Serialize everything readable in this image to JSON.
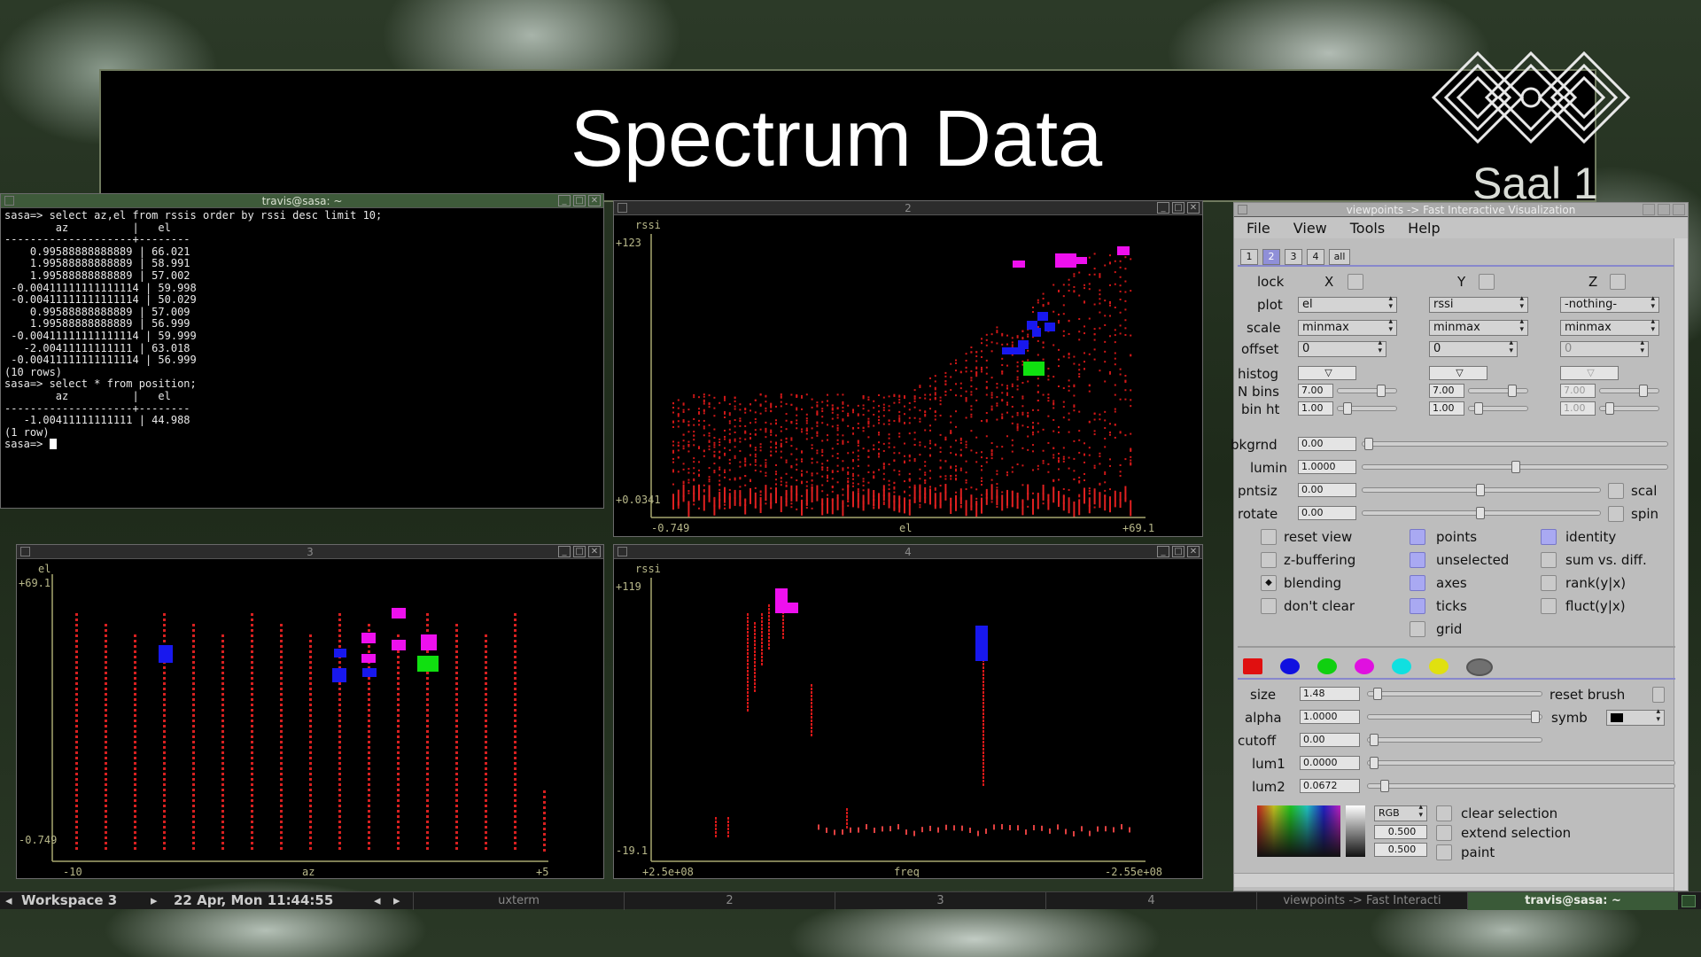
{
  "slide": {
    "title": "Spectrum Data",
    "logo_text": "Saal 1"
  },
  "terminal": {
    "title": "travis@sasa: ~",
    "lines": [
      "sasa=> select az,el from rssis order by rssi desc limit 10;",
      "        az          |   el",
      "--------------------+--------",
      "    0.99588888888889 | 66.021",
      "    1.99588888888889 | 58.991",
      "    1.99588888888889 | 57.002",
      " -0.00411111111111114 | 59.998",
      " -0.00411111111111114 | 50.029",
      "    0.99588888888889 | 57.009",
      "    1.99588888888889 | 56.999",
      " -0.00411111111111114 | 59.999",
      "   -2.00411111111111 | 63.018",
      " -0.00411111111111114 | 56.999",
      "(10 rows)",
      "",
      "sasa=> select * from position;",
      "        az          |   el",
      "--------------------+--------",
      "   -1.00411111111111 | 44.988",
      "(1 row)",
      "",
      "sasa=> "
    ]
  },
  "plot2": {
    "title": "2",
    "ylabel": "rssi",
    "xlabel": "el",
    "ymax": "+123",
    "ymin": "+0.0341",
    "xmin": "-0.749",
    "xmax": "+69.1"
  },
  "plot3": {
    "title": "3",
    "ylabel": "el",
    "xlabel": "az",
    "ymax": "+69.1",
    "ymin": "-0.749",
    "xmin": "-10",
    "xmax": "+5"
  },
  "plot4": {
    "title": "4",
    "ylabel": "rssi",
    "xlabel": "freq",
    "ymax": "+119",
    "ymin": "-19.1",
    "xmin": "+2.5e+08",
    "xmax": "-2.55e+08"
  },
  "viewpoints": {
    "title": "viewpoints -> Fast Interactive Visualization",
    "menu": [
      "File",
      "View",
      "Tools",
      "Help"
    ],
    "tabs": [
      "1",
      "2",
      "3",
      "4",
      "all"
    ],
    "labels": {
      "lock": "lock",
      "x": "X",
      "y": "Y",
      "z": "Z",
      "plot": "plot",
      "scale": "scale",
      "offset": "offset",
      "histog": "histog",
      "nbins": "N bins",
      "binht": "bin ht",
      "bkgrnd": "bkgrnd",
      "lumin": "lumin",
      "pntsiz": "pntsiz",
      "rotate": "rotate",
      "scale_short": "scal",
      "spin": "spin"
    },
    "plot_vars": [
      "el",
      "rssi",
      "-nothing-"
    ],
    "scales": [
      "minmax",
      "minmax",
      "minmax"
    ],
    "offsets": [
      "0",
      "0",
      "0"
    ],
    "nbins": [
      "7.00",
      "7.00",
      "7.00"
    ],
    "binht": [
      "1.00",
      "1.00",
      "1.00"
    ],
    "bkgrnd": "0.00",
    "lumin": "1.0000",
    "pntsiz": "0.00",
    "rotate": "0.00",
    "options": [
      "reset view",
      "z-buffering",
      "blending",
      "don't clear",
      "points",
      "unselected",
      "axes",
      "ticks",
      "grid",
      "identity",
      "sum vs. diff.",
      "rank(y|x)",
      "fluct(y|x)"
    ],
    "brush": {
      "size_label": "size",
      "size": "1.48",
      "alpha_label": "alpha",
      "alpha": "1.0000",
      "cutoff_label": "cutoff",
      "cutoff": "0.00",
      "lum1_label": "lum1",
      "lum1": "0.0000",
      "lum2_label": "lum2",
      "lum2": "0.0672",
      "reset_brush": "reset brush",
      "symb": "symb",
      "color_mode": "RGB",
      "v1": "0.500",
      "v2": "0.500",
      "clear_selection": "clear selection",
      "extend_selection": "extend selection",
      "paint": "paint"
    },
    "colors": [
      "#e01010",
      "#1010e0",
      "#10d010",
      "#e010e0",
      "#10e0e0",
      "#e0e010",
      "#707070"
    ]
  },
  "taskbar": {
    "workspace": "Workspace 3",
    "clock": "22 Apr, Mon 11:44:55",
    "tasks": [
      "uxterm",
      "2",
      "3",
      "4",
      "viewpoints -> Fast Interacti",
      "travis@sasa: ~"
    ]
  }
}
